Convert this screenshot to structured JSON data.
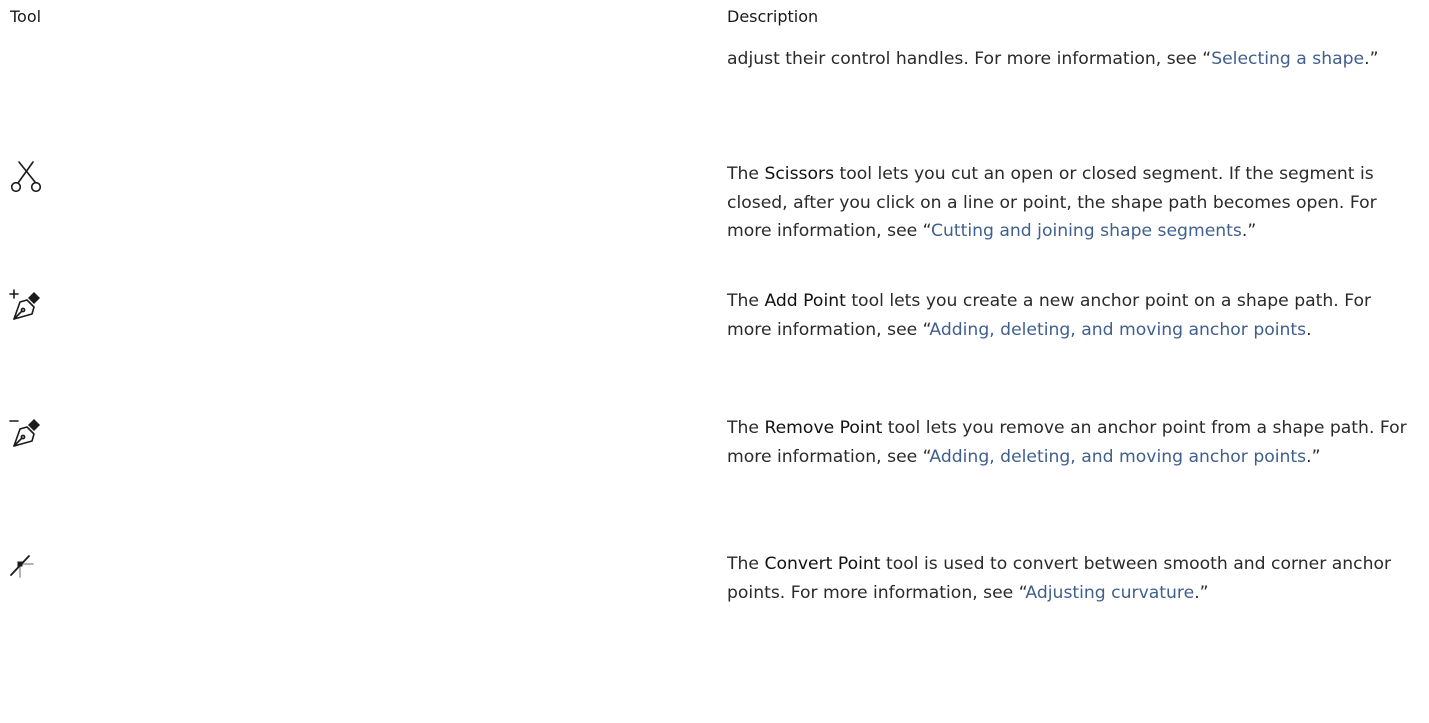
{
  "header": {
    "tool": "Tool",
    "description": "Description"
  },
  "rows": [
    {
      "icon": "none",
      "pre": "adjust their control handles. For more information, see “",
      "link": "Selecting a shape",
      "post": ".”"
    },
    {
      "icon": "scissors-icon",
      "pre": "The ",
      "name": "Scissors",
      "mid": " tool lets you cut an open or closed segment. If the segment is closed, after you click on a line or point, the shape path becomes open. For more information, see “",
      "link": "Cutting and joining shape segments",
      "post": ".”"
    },
    {
      "icon": "add-point-pen-icon",
      "pre": "The ",
      "name": "Add Point",
      "mid": " tool lets you create a new anchor point on a shape path. For more information, see “",
      "link": "Adding, deleting, and moving anchor points",
      "post": "."
    },
    {
      "icon": "remove-point-pen-icon",
      "pre": "The ",
      "name": "Remove Point",
      "mid": " tool lets you remove an anchor point from a shape path. For more information, see “",
      "link": "Adding, deleting, and moving anchor points",
      "post": ".”"
    },
    {
      "icon": "convert-point-icon",
      "pre": "The ",
      "name": "Convert Point",
      "mid": " tool is used to convert between smooth and corner anchor points. For more information, see “",
      "link": "Adjusting curvature",
      "post": ".”"
    }
  ],
  "colors": {
    "link": "#3f5f8f",
    "text": "#2a2a2a"
  }
}
